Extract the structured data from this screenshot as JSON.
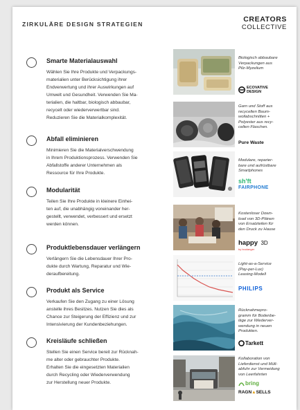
{
  "header": {
    "title": "ZIRKULÄRE DESIGN STRATEGIEN",
    "brand_line1": "CREATORS",
    "brand_line2": "COLLECTIVE"
  },
  "strategies": [
    {
      "title": "Smarte Materialauswahl",
      "text": "Wählen Sie Ihre Produkte und Verpackungs-\nmaterialien unter Berücksichtigung ihrer\nEndverwertung und ihrer Auswirkungen auf\nUmwelt und Gesundheit. Verwenden Sie Ma-\nterialien, die haltbar, biologisch abbaubar,\nrecycelt oder wiederverwertbar sind.\nReduzieren Sie die Materialkomplexität."
    },
    {
      "title": "Abfall eliminieren",
      "text": "Minimieren Sie die Materialverschwendung\nin Ihrem Produktionsprozess. Verwenden Sie\nAbfallstoffe anderer Unternehmen als\nRessource für Ihre Produkte."
    },
    {
      "title": "Modularität",
      "text": "Teilen Sie Ihre Produkte in kleinere Einhei-\nten auf, die unabhängig voneinander her-\ngestellt, verwendet, verbessert und ersetzt\nwerden können."
    },
    {
      "title": "Produktlebensdauer verlängern",
      "text": "Verlängern Sie die Lebensdauer Ihrer Pro-\ndukte durch Wartung, Reparatur und Wie-\nderaufbereitung."
    },
    {
      "title": "Produkt als Service",
      "text": "Verkaufen Sie den Zugang zu einer Lösung\nanstelle ihres Besitzes. Nutzen Sie dies als\nChance zur Steigerung der Effizienz und zur\nIntensivierung der Kundenbeziehungen."
    },
    {
      "title": "Kreisläufe schließen",
      "text": "Stellen Sie einen Service bereit zur Rücknah-\nme alter oder gebrauchter Produkte.\nErhalten Sie die eingesetzten Materialien\ndurch Recycling oder Wiederverwendung\nzur Herstellung neuer Produkte."
    }
  ],
  "examples": [
    {
      "desc": "Biologisch abbaubare\nVerpackungen aus\nPilz-Myzelium",
      "logo_line1": "ECOVATIVE",
      "logo_line2": "DESIGN"
    },
    {
      "desc": "Garn und Stoff aus\nrecycelten Baum-\nwollabschnitten +\nPolyester aus recy-\ncelten Flaschen.",
      "logo": "Pure Waste"
    },
    {
      "desc": "Modulare, reparier-\nbare und aufrüstbare\nSmartphones",
      "logo_line1": "sh'ft",
      "logo_line2": "FAIRPHONE"
    },
    {
      "desc": "Kostenloser Down-\nload von 3D-Plänen\nvon Ersatzteilen für\nden Druck zu Hause",
      "logo_main": "happy",
      "logo_suffix": "3D",
      "logo_sub": "by boulanger"
    },
    {
      "desc": "Light-as-a-Service\n(Pay-per-Lux)\nLeasing-Modell",
      "logo": "PHILIPS"
    },
    {
      "desc": "Rücknahmepro-\ngramm für Bodenbe-\nläge zur Wiederver-\nwendung in neuen\nProdukten.",
      "logo": "Tarkett"
    },
    {
      "desc": "Kollaboration von\nLieferdienst und Müll-\nabfuhr zur Vermeidung\nvon Leerfahrten",
      "logo_line1": "bring",
      "logo_line2": "RAGN",
      "logo_line3": "SELLS"
    }
  ],
  "colors": {
    "philips_blue": "#0b5ed7",
    "fairphone_blue": "#1f7ad1",
    "shift_green": "#2bb673",
    "bring_green": "#5fae3e"
  }
}
